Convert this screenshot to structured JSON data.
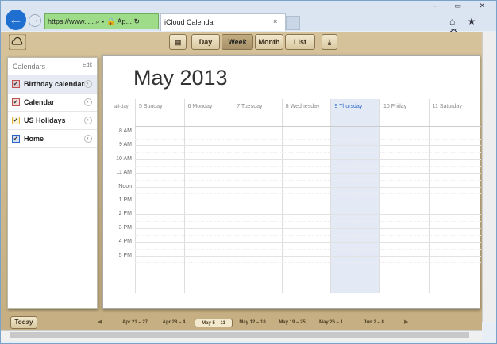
{
  "browser": {
    "address": "https://www.i... ⌕ ▾ 🔒 Ap... ↻",
    "tab_title": "iCloud Calendar",
    "tab_close": "×",
    "window_controls": "– ▭ ✕",
    "nav_icons": "⌂ ★ ⚙"
  },
  "toolbar": {
    "day": "Day",
    "week": "Week",
    "month": "Month",
    "list": "List"
  },
  "sidebar": {
    "title": "Calendars",
    "edit": "Edit",
    "items": [
      {
        "label": "Birthday calendar",
        "color": "#c0504d"
      },
      {
        "label": "Calendar",
        "color": "#c0504d"
      },
      {
        "label": "US Holidays",
        "color": "#e8b830"
      },
      {
        "label": "Home",
        "color": "#2a67c7"
      }
    ]
  },
  "calendar": {
    "month": "May 2013",
    "allday": "all-day",
    "days": [
      "5 Sunday",
      "6 Monday",
      "7 Tuesday",
      "8 Wednesday",
      "9 Thursday",
      "10 Friday",
      "11 Saturday"
    ],
    "hours": [
      "8 AM",
      "9 AM",
      "10 AM",
      "11 AM",
      "Noon",
      "1 PM",
      "2 PM",
      "3 PM",
      "4 PM",
      "5 PM"
    ],
    "today_index": 4,
    "today_color": "#e3eaf6"
  },
  "bottom": {
    "today": "Today",
    "weeks": [
      "Apr 21 – 27",
      "Apr 28 – 4",
      "May 5 – 11",
      "May 12 – 18",
      "May 19 – 25",
      "May 26 – 1",
      "Jun 2 – 8"
    ],
    "selected_week": 2,
    "prev": "◀",
    "next": "▶"
  }
}
